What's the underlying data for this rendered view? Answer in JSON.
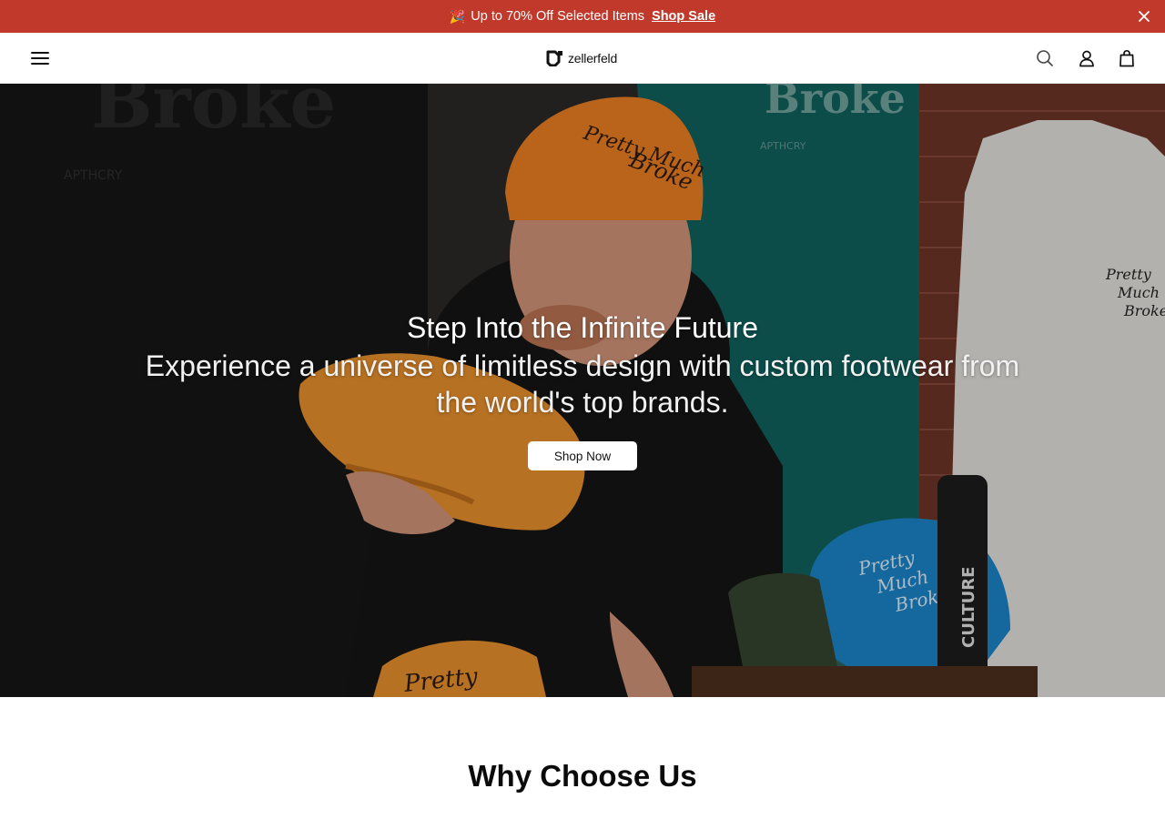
{
  "announcement": {
    "emoji": "🎉",
    "message": "Up to 70% Off Selected Items",
    "link_label": "Shop Sale"
  },
  "header": {
    "logo_text": "zellerfeld",
    "icons": [
      "menu-icon",
      "search-icon",
      "account-icon",
      "bag-icon",
      "close-icon"
    ]
  },
  "hero": {
    "headline": "Step Into the Infinite Future",
    "subline": "Experience a universe of limitless design with custom footwear from the world's top brands.",
    "cta_label": "Shop Now",
    "image_text": {
      "cap": "Pretty Much Broke",
      "shirt_back": "Broke",
      "shirt_brand": "APTHCRY",
      "white_shirt": "Pretty Much Broke",
      "bottle": "CULTURE"
    }
  },
  "section": {
    "title": "Why Choose Us"
  },
  "colors": {
    "announce_bg": "#c0392b",
    "header_bg": "#ffffff",
    "cta_bg": "#ffffff",
    "text_dark": "#111111"
  }
}
